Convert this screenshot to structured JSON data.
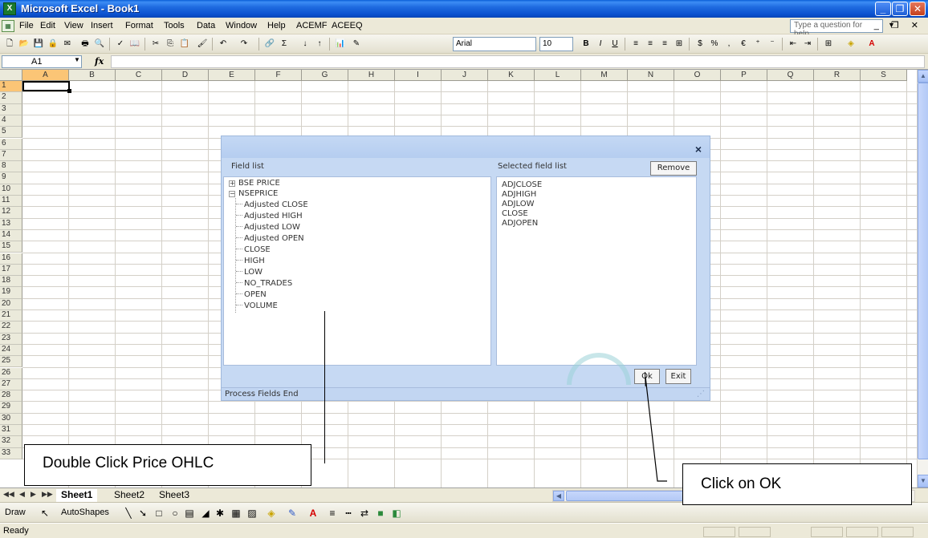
{
  "window": {
    "title": "Microsoft Excel - Book1",
    "app_icon": "excel-icon"
  },
  "menu": {
    "items": [
      "File",
      "Edit",
      "View",
      "Insert",
      "Format",
      "Tools",
      "Data",
      "Window",
      "Help",
      "ACEMF",
      "ACEEQ"
    ],
    "help_placeholder": "Type a question for help"
  },
  "toolbar": {
    "font": "Arial",
    "size": "10",
    "currency": "$",
    "percent": "%",
    "euro": "€"
  },
  "formula_bar": {
    "cell_ref": "A1",
    "fx": "fx",
    "value": ""
  },
  "grid": {
    "columns": [
      "A",
      "B",
      "C",
      "D",
      "E",
      "F",
      "G",
      "H",
      "I",
      "J",
      "K",
      "L",
      "M",
      "N",
      "O",
      "P",
      "Q",
      "R",
      "S"
    ],
    "rows": [
      "1",
      "2",
      "3",
      "4",
      "5",
      "6",
      "7",
      "8",
      "9",
      "10",
      "11",
      "12",
      "13",
      "14",
      "15",
      "16",
      "17",
      "18",
      "19",
      "20",
      "21",
      "22",
      "23",
      "24",
      "25",
      "26",
      "27",
      "28",
      "29",
      "30",
      "31",
      "32",
      "33"
    ],
    "active_cell": "A1"
  },
  "sheets": [
    "Sheet1",
    "Sheet2",
    "Sheet3"
  ],
  "draw_toolbar": {
    "draw": "Draw",
    "autoshapes": "AutoShapes"
  },
  "status": {
    "text": "Ready"
  },
  "dialog": {
    "field_list_label": "Field list",
    "selected_label": "Selected field list",
    "remove_label": "Remove",
    "tree": [
      {
        "label": "BSE PRICE",
        "expanded": false
      },
      {
        "label": "NSEPRICE",
        "expanded": true,
        "children": [
          "Adjusted CLOSE",
          "Adjusted HIGH",
          "Adjusted LOW",
          "Adjusted OPEN",
          "CLOSE",
          "HIGH",
          "LOW",
          "NO_TRADES",
          "OPEN",
          "VOLUME"
        ]
      }
    ],
    "selected": [
      "ADJCLOSE",
      "ADJHIGH",
      "ADJLOW",
      "CLOSE",
      "ADJOPEN"
    ],
    "ok_label": "Ok",
    "exit_label": "Exit",
    "footer": "Process Fields  End",
    "close_glyph": "×"
  },
  "annotations": {
    "double_click": "Double Click Price OHLC",
    "click_ok": "Click on OK"
  }
}
